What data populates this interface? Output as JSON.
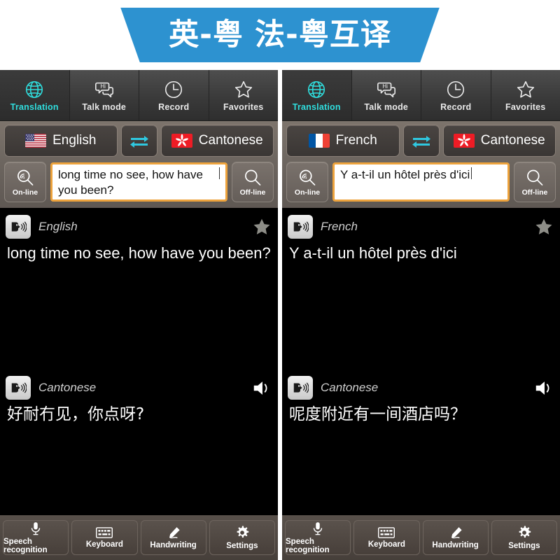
{
  "banner": {
    "title": "英-粤 法-粤互译",
    "color": "#2d92d0"
  },
  "colors": {
    "accent_cyan": "#2fdede",
    "field_border": "#eda33d",
    "panel_bg": "#000000"
  },
  "panels": [
    {
      "nav": {
        "items": [
          {
            "label": "Translation",
            "icon": "globe-icon",
            "active": true
          },
          {
            "label": "Talk mode",
            "icon": "speech-bubbles-icon",
            "active": false
          },
          {
            "label": "Record",
            "icon": "clock-icon",
            "active": false
          },
          {
            "label": "Favorites",
            "icon": "star-outline-icon",
            "active": false
          }
        ]
      },
      "language": {
        "source": {
          "label": "English",
          "flag": "us-flag-icon"
        },
        "target": {
          "label": "Cantonese",
          "flag": "hk-flag-icon"
        },
        "swap_icon": "swap-arrows-icon"
      },
      "input": {
        "online_label": "On-line",
        "online_icon": "magnifier-wifi-icon",
        "offline_label": "Off-line",
        "offline_icon": "magnifier-icon",
        "value": "long time no see, how have you been?",
        "placeholder": "",
        "has_caret": true
      },
      "results": {
        "source": {
          "lang_label": "English",
          "text": "long time no see, how have you been?",
          "speaker_icon": "speaker-head-icon",
          "action_icon": "star-filled-icon"
        },
        "target": {
          "lang_label": "Cantonese",
          "text": "好耐冇见，你点呀?",
          "speaker_icon": "speaker-head-icon",
          "action_icon": "volume-icon"
        }
      },
      "bottom": {
        "items": [
          {
            "label": "Speech recognition",
            "icon": "microphone-icon"
          },
          {
            "label": "Keyboard",
            "icon": "keyboard-icon"
          },
          {
            "label": "Handwriting",
            "icon": "pen-icon"
          },
          {
            "label": "Settings",
            "icon": "gear-icon"
          }
        ]
      }
    },
    {
      "nav": {
        "items": [
          {
            "label": "Translation",
            "icon": "globe-icon",
            "active": true
          },
          {
            "label": "Talk mode",
            "icon": "speech-bubbles-icon",
            "active": false
          },
          {
            "label": "Record",
            "icon": "clock-icon",
            "active": false
          },
          {
            "label": "Favorites",
            "icon": "star-outline-icon",
            "active": false
          }
        ]
      },
      "language": {
        "source": {
          "label": "French",
          "flag": "fr-flag-icon"
        },
        "target": {
          "label": "Cantonese",
          "flag": "hk-flag-icon"
        },
        "swap_icon": "swap-arrows-icon"
      },
      "input": {
        "online_label": "On-line",
        "online_icon": "magnifier-wifi-icon",
        "offline_label": "Off-line",
        "offline_icon": "magnifier-icon",
        "value": "Y a-t-il un hôtel près d'ici",
        "placeholder": "",
        "has_caret": true
      },
      "results": {
        "source": {
          "lang_label": "French",
          "text": "Y a-t-il un hôtel près d'ici",
          "speaker_icon": "speaker-head-icon",
          "action_icon": "star-filled-icon"
        },
        "target": {
          "lang_label": "Cantonese",
          "text": "呢度附近有一间酒店吗？",
          "speaker_icon": "speaker-head-icon",
          "action_icon": "volume-icon"
        }
      },
      "bottom": {
        "items": [
          {
            "label": "Speech recognition",
            "icon": "microphone-icon"
          },
          {
            "label": "Keyboard",
            "icon": "keyboard-icon"
          },
          {
            "label": "Handwriting",
            "icon": "pen-icon"
          },
          {
            "label": "Settings",
            "icon": "gear-icon"
          }
        ]
      }
    }
  ]
}
